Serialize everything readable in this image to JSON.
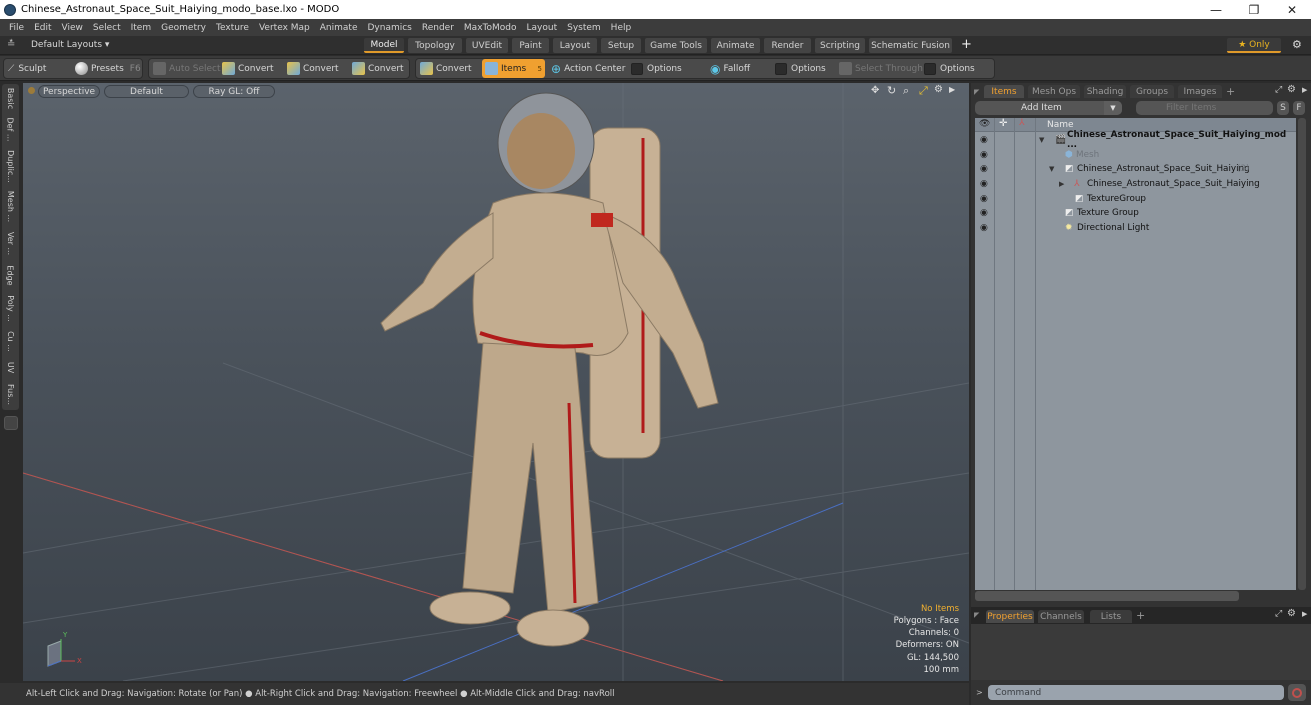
{
  "window": {
    "title": "Chinese_Astronaut_Space_Suit_Haiying_modo_base.lxo - MODO",
    "controls": {
      "minimize": "—",
      "restore": "❐",
      "close": "✕"
    }
  },
  "menu": [
    "File",
    "Edit",
    "View",
    "Select",
    "Item",
    "Geometry",
    "Texture",
    "Vertex Map",
    "Animate",
    "Dynamics",
    "Render",
    "MaxToModo",
    "Layout",
    "System",
    "Help"
  ],
  "layoutbar": {
    "layouts_label": "Default Layouts ▾",
    "tabs": [
      "Model",
      "Topology",
      "UVEdit",
      "Paint",
      "Layout",
      "Setup",
      "Game Tools",
      "Animate",
      "Render",
      "Scripting",
      "Schematic Fusion"
    ],
    "active_tab": "Model",
    "add_label": "+",
    "only_label": "★ Only",
    "gear": "⚙"
  },
  "toolbar": {
    "sculpt": "Sculpt",
    "presets": "Presets",
    "presets_key": "F6",
    "auto_select": "Auto Select",
    "convert1": "Convert",
    "convert2": "Convert",
    "convert3": "Convert",
    "convert4": "Convert",
    "items": "Items",
    "items_key": "5",
    "action_center": "Action Center",
    "options1": "Options",
    "falloff": "Falloff",
    "options2": "Options",
    "select_through": "Select Through",
    "options3": "Options"
  },
  "lefttabs": [
    "Basic",
    "Def ...",
    "Duplic...",
    "Mesh ...",
    "Ver ...",
    "Edge",
    "Poly ...",
    "Cu ...",
    "UV",
    "Fus..."
  ],
  "viewport": {
    "view_mode": "Perspective",
    "shading": "Default",
    "raygl": "Ray GL: Off",
    "info": {
      "selection": "No Items",
      "polygons": "Polygons : Face",
      "channels": "Channels: 0",
      "deformers": "Deformers: ON",
      "gl": "GL: 144,500",
      "scale": "100 mm"
    },
    "axis_labels": {
      "y": "Y",
      "x": "X"
    }
  },
  "status": "Alt-Left Click and Drag: Navigation: Rotate (or Pan) ● Alt-Right Click and Drag: Navigation: Freewheel ● Alt-Middle Click and Drag: navRoll",
  "items_panel": {
    "tabs": [
      "Items",
      "Mesh Ops",
      "Shading",
      "Groups",
      "Images"
    ],
    "active_tab": "Items",
    "add_tab": "+",
    "add_item": "Add Item",
    "filter_placeholder": "Filter Items",
    "s_btn": "S",
    "f_btn": "F",
    "column_name": "Name",
    "rows": [
      {
        "label": "Chinese_Astronaut_Space_Suit_Haiying_mod ...",
        "bold": true,
        "icon": "scene"
      },
      {
        "label": "Mesh",
        "dim": true,
        "icon": "mesh"
      },
      {
        "label": "Chinese_Astronaut_Space_Suit_Haiying",
        "suffix": "(3)",
        "icon": "group"
      },
      {
        "label": "Chinese_Astronaut_Space_Suit_Haiying",
        "icon": "locator"
      },
      {
        "label": "TextureGroup",
        "icon": "group"
      },
      {
        "label": "Texture Group",
        "icon": "group"
      },
      {
        "label": "Directional Light",
        "icon": "light"
      }
    ]
  },
  "properties_panel": {
    "tabs": [
      "Properties",
      "Channels",
      "Lists"
    ],
    "active_tab": "Properties",
    "add_tab": "+"
  },
  "command": {
    "placeholder": "Command",
    "prompt": ">"
  }
}
